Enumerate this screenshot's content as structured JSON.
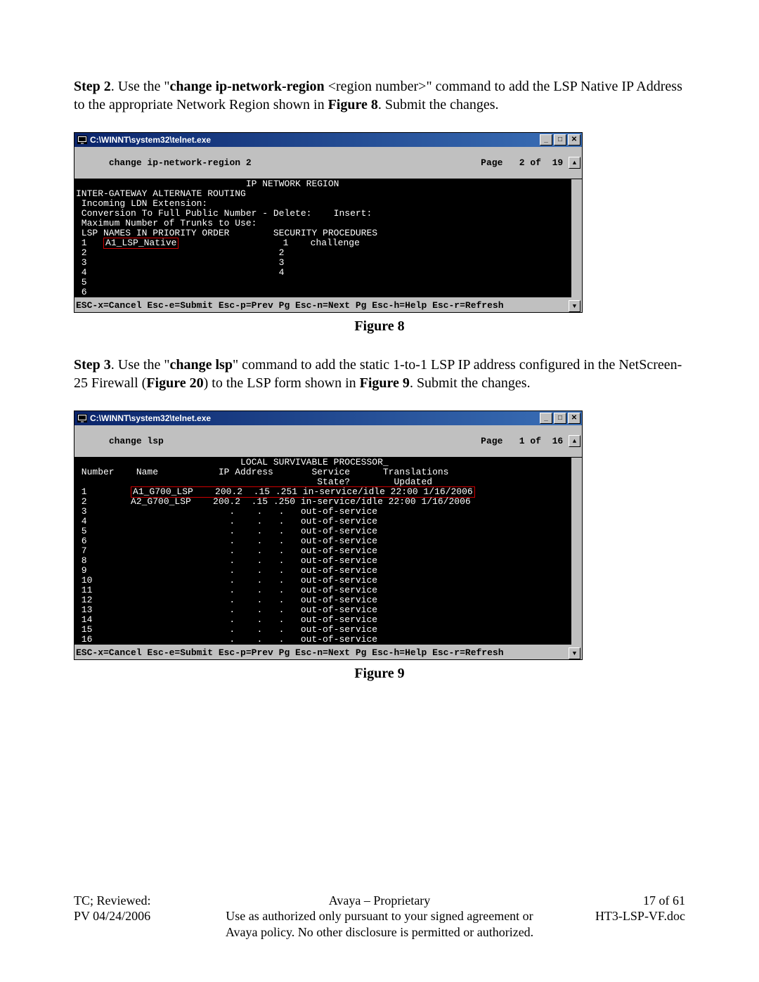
{
  "step2": {
    "label": "Step 2",
    "pre": ". Use the \"",
    "cmd": "change ip-network-region ",
    "arg": "<region number>",
    "mid": "\" command to add the LSP Native IP Address to the appropriate Network Region shown in ",
    "figref": "Figure 8",
    "tail": ". Submit the changes."
  },
  "fig8": {
    "title": "C:\\WINNT\\system32\\telnet.exe",
    "cmd_left": "change ip-network-region 2",
    "cmd_right": "Page   2 of  19 ",
    "lines": [
      "                               IP NETWORK REGION",
      "",
      "",
      "INTER-GATEWAY ALTERNATE ROUTING",
      " Incoming LDN Extension:",
      " Conversion To Full Public Number - Delete:    Insert:",
      " Maximum Number of Trunks to Use:",
      "",
      " LSP NAMES IN PRIORITY ORDER        SECURITY PROCEDURES",
      " 1   A1_LSP_Native                   1    challenge",
      " 2                                   2",
      " 3                                   3",
      " 4                                   4",
      " 5",
      " 6",
      "",
      "",
      "",
      "",
      "",
      ""
    ],
    "hl_row": 9,
    "hl_text": "A1_LSP_Native",
    "footer": "ESC-x=Cancel Esc-e=Submit Esc-p=Prev Pg Esc-n=Next Pg Esc-h=Help Esc-r=Refresh",
    "caption": "Figure 8"
  },
  "step3": {
    "label": "Step 3",
    "pre": ". Use the \"",
    "cmd": "change lsp",
    "mid1": "\" command to add the static 1-to-1 LSP IP address configured in the NetScreen-25 Firewall (",
    "figref1": "Figure 20",
    "mid2": ") to the LSP form shown in ",
    "figref2": "Figure 9",
    "tail": ". Submit the changes."
  },
  "fig9": {
    "title": "C:\\WINNT\\system32\\telnet.exe",
    "cmd_left": "change lsp",
    "cmd_right": "Page   1 of  16 ",
    "lines": [
      "                              LOCAL SURVIVABLE PROCESSOR_",
      " Number    Name           IP Address       Service      Translations",
      "                                            State?        Updated",
      " 1        A1_G700_LSP    200.2  .15 .251 in-service/idle 22:00 1/16/2006",
      " 2        A2_G700_LSP    200.2  .15 .250 in-service/idle 22:00 1/16/2006",
      " 3                          .    .   .   out-of-service",
      " 4                          .    .   .   out-of-service",
      " 5                          .    .   .   out-of-service",
      " 6                          .    .   .   out-of-service",
      " 7                          .    .   .   out-of-service",
      " 8                          .    .   .   out-of-service",
      " 9                          .    .   .   out-of-service",
      " 10                         .    .   .   out-of-service",
      " 11                         .    .   .   out-of-service",
      " 12                         .    .   .   out-of-service",
      " 13                         .    .   .   out-of-service",
      " 14                         .    .   .   out-of-service",
      " 15                         .    .   .   out-of-service",
      " 16                         .    .   .   out-of-service",
      ""
    ],
    "hl_row": 3,
    "hl_text": "A1_G700_LSP    200.2  .15 .251 in-service/idle 22:00 1/16/2006",
    "footer": "ESC-x=Cancel Esc-e=Submit Esc-p=Prev Pg Esc-n=Next Pg Esc-h=Help Esc-r=Refresh",
    "caption": "Figure 9"
  },
  "footer": {
    "l1": "TC; Reviewed:",
    "l2": "PV 04/24/2006",
    "c1": "Avaya – Proprietary",
    "c2": "Use as authorized only pursuant to your signed agreement or",
    "c3": "Avaya policy. No other disclosure is permitted or authorized.",
    "r1": "17 of 61",
    "r2": "HT3-LSP-VF.doc"
  },
  "winbtn": {
    "min": "_",
    "max": "□",
    "close": "✕",
    "up": "▲",
    "down": "▼"
  }
}
